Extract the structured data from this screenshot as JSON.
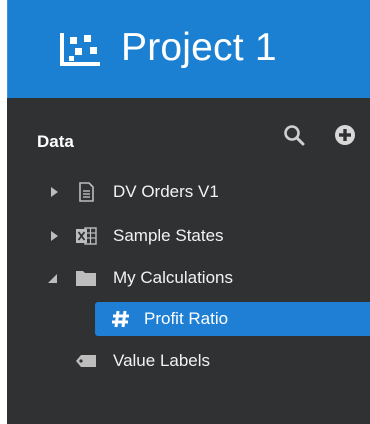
{
  "header": {
    "title": "Project 1",
    "logo_icon": "scatter-chart-logo-icon",
    "background_color": "#1b80d2"
  },
  "data_panel": {
    "title": "Data",
    "search_icon": "search-icon",
    "add_icon": "add-circle-icon",
    "background_color": "#2f3133",
    "selection_color": "#1e7fd4",
    "items": [
      {
        "label": "DV Orders V1",
        "icon": "document-icon",
        "expanded": false
      },
      {
        "label": "Sample States",
        "icon": "excel-file-icon",
        "expanded": false
      },
      {
        "label": "My Calculations",
        "icon": "folder-icon",
        "expanded": true
      },
      {
        "label": "Profit Ratio",
        "icon": "hash-icon",
        "selected": true
      },
      {
        "label": "Value Labels",
        "icon": "tag-icon"
      }
    ]
  }
}
